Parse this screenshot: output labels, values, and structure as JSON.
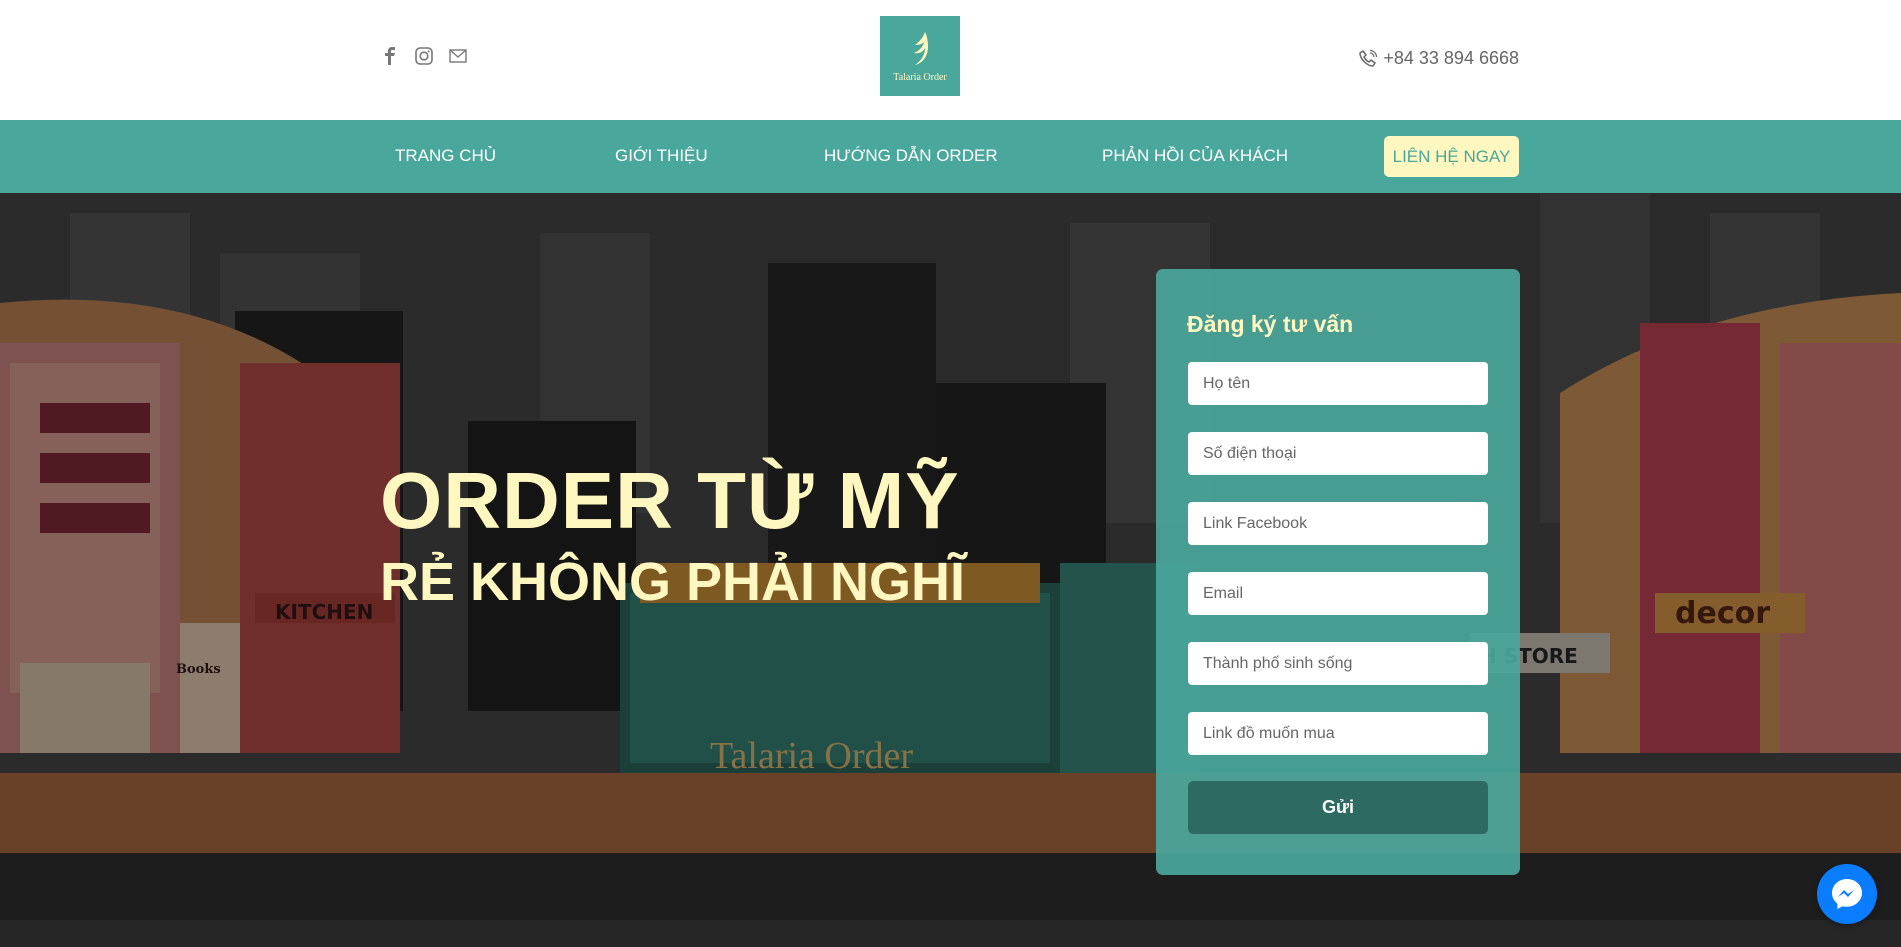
{
  "header": {
    "social": [
      {
        "icon": "facebook-icon"
      },
      {
        "icon": "instagram-icon"
      },
      {
        "icon": "mail-icon"
      }
    ],
    "logo_text": "Talaria Order",
    "phone": "+84 33 894 6668"
  },
  "nav": {
    "items": [
      "TRANG CHỦ",
      "GIỚI THIỆU",
      "HƯỚNG DẪN ORDER",
      "PHẢN HỒI CỦA KHÁCH"
    ],
    "cta": "LIÊN HỆ NGAY"
  },
  "hero": {
    "headline": "ORDER TỪ MỸ",
    "subheadline": "RẺ KHÔNG PHẢI NGHĨ",
    "background_labels": {
      "kitchen": "KITCHEN",
      "books": "Books",
      "truck_brand": "Talaria Order",
      "decor": "decor",
      "store": "H STORE"
    }
  },
  "form": {
    "title": "Đăng ký tư vấn",
    "fields": [
      {
        "placeholder": "Họ tên"
      },
      {
        "placeholder": "Số điện thoại"
      },
      {
        "placeholder": "Link Facebook"
      },
      {
        "placeholder": "Email"
      },
      {
        "placeholder": "Thành phố sinh sống"
      },
      {
        "placeholder": "Link đồ muốn mua"
      }
    ],
    "submit": "Gửi"
  },
  "colors": {
    "brand": "#4aa79b",
    "accent": "#fff7c0",
    "button_dark": "#2d6b62",
    "messenger": "#0a7cff"
  }
}
